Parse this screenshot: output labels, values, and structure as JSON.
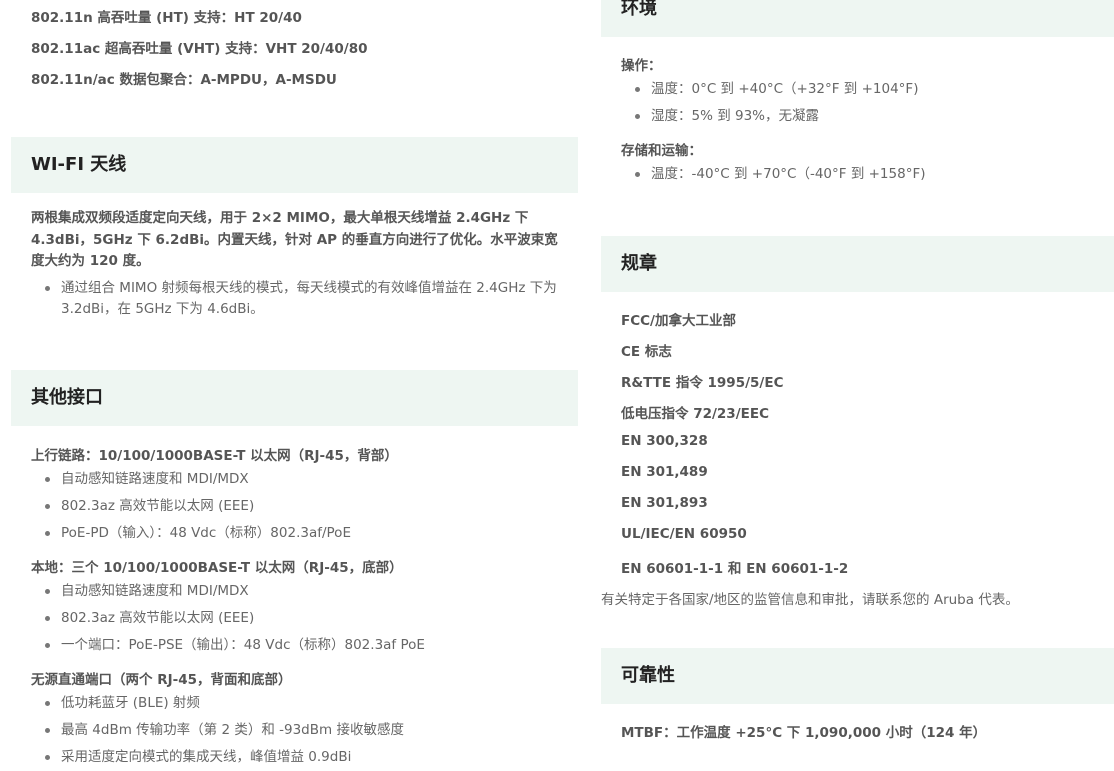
{
  "left": {
    "top_lines": [
      "802.11n 高吞吐量 (HT) 支持：HT 20/40",
      "802.11ac 超高吞吐量 (VHT) 支持：VHT 20/40/80",
      "802.11n/ac 数据包聚合：A-MPDU，A-MSDU"
    ],
    "wifi": {
      "title": "WI-FI 天线",
      "para_line1": "两根集成双频段适度定向天线，用于 2×2 MIMO，最大单根天线增益 2.4GHz 下",
      "para_line2": "4.3dBi，5GHz 下 6.2dBi。内置天线，针对 AP 的垂直方向进行了优化。水平波束宽",
      "para_line3": "度大约为 120 度。",
      "bullet_line1": "通过组合 MIMO 射频每根天线的模式，每天线模式的有效峰值增益在 2.4GHz 下为",
      "bullet_line2": "3.2dBi，在 5GHz 下为 4.6dBi。"
    },
    "other": {
      "title": "其他接口",
      "uplink": {
        "heading": "上行链路：10/100/1000BASE-T 以太网（RJ-45，背部）",
        "items": [
          "自动感知链路速度和 MDI/MDX",
          "802.3az 高效节能以太网 (EEE)",
          "PoE-PD（输入）：48 Vdc（标称）802.3af/PoE"
        ]
      },
      "local": {
        "heading": "本地：三个 10/100/1000BASE-T 以太网（RJ-45，底部）",
        "items": [
          "自动感知链路速度和 MDI/MDX",
          "802.3az 高效节能以太网 (EEE)",
          "一个端口：PoE-PSE（输出）：48 Vdc（标称）802.3af PoE"
        ]
      },
      "passthrough": {
        "heading": "无源直通端口（两个 RJ-45，背面和底部）",
        "items": [
          "低功耗蓝牙 (BLE) 射频",
          "最高 4dBm 传输功率（第 2 类）和 -93dBm 接收敏感度",
          "采用适度定向模式的集成天线，峰值增益 0.9dBi"
        ]
      }
    }
  },
  "right": {
    "env": {
      "title": "环境",
      "op_heading": "操作：",
      "op_items": [
        "温度：0°C 到 +40°C（+32°F 到 +104°F)",
        "湿度：5% 到 93%，无凝露"
      ],
      "storage_heading": "存储和运输：",
      "storage_items": [
        "温度：-40°C 到 +70°C（-40°F 到 +158°F)"
      ]
    },
    "reg": {
      "title": "规章",
      "items": [
        "FCC/加拿大工业部",
        "CE 标志",
        "R&TTE 指令 1995/5/EC",
        "低电压指令 72/23/EEC",
        "EN 300,328",
        "EN 301,489",
        "EN 301,893",
        "UL/IEC/EN 60950",
        "EN 60601-1-1 和 EN 60601-1-2"
      ],
      "note": "有关特定于各国家/地区的监管信息和审批，请联系您的 Aruba 代表。"
    },
    "rel": {
      "title": "可靠性",
      "mtbf": "MTBF：工作温度 +25°C 下 1,090,000 小时（124 年）"
    }
  }
}
